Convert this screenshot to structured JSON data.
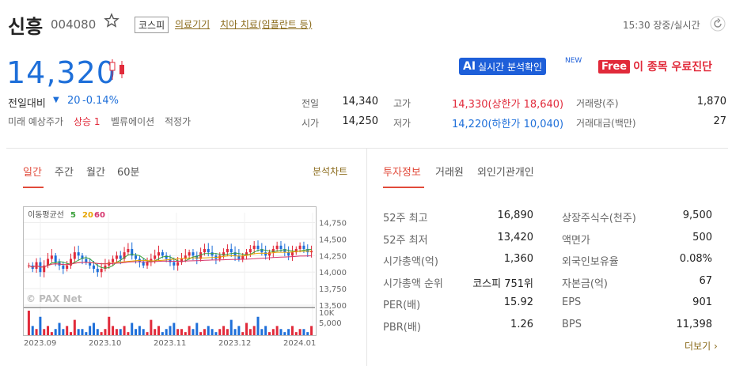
{
  "header": {
    "stock_name": "신흥",
    "stock_code": "004080",
    "market_tag": "코스피",
    "sector_link": "의료기기",
    "theme_link": "치아 치료(임플란트 등)",
    "time_status": "15:30 장중/실시간"
  },
  "price": {
    "current": "14,320",
    "change_label": "전일대비",
    "change_value": "20",
    "change_pct": "-0.14%",
    "forecast_label": "미래 예상주가",
    "forecast_value": "상승 1",
    "valuation_label": "벨류에이션",
    "valuation_value": "적정가"
  },
  "promo": {
    "ai_badge": "AI",
    "ai_text": "실시간 분석확인",
    "new_tag": "NEW",
    "free_badge": "Free",
    "free_text": "이 종목 우료진단"
  },
  "quote": {
    "prev_label": "전일",
    "prev_value": "14,340",
    "open_label": "시가",
    "open_value": "14,250",
    "high_label": "고가",
    "high_value": "14,330(상한가 18,640)",
    "low_label": "저가",
    "low_value": "14,220(하한가 10,040)",
    "volume_label": "거래량(주)",
    "volume_value": "1,870",
    "amount_label": "거래대금(백만)",
    "amount_value": "27"
  },
  "chart_tabs": [
    "일간",
    "주간",
    "월간",
    "60분"
  ],
  "chart_link": "분석차트",
  "info_tabs": [
    "투자정보",
    "거래원",
    "외인기관개인"
  ],
  "chart_data": {
    "type": "candlestick",
    "legend": {
      "label": "이동평균선",
      "ma": [
        "5",
        "20",
        "60"
      ],
      "colors": [
        "#3aa03a",
        "#e6a400",
        "#d6336c"
      ]
    },
    "watermark": "© PAX Net",
    "y_ticks": [
      "14,750",
      "14,500",
      "14,250",
      "14,000",
      "13,750",
      "13,500"
    ],
    "volume_ticks": [
      "10K",
      "5,000"
    ],
    "x_ticks": [
      "2023.09",
      "2023.10",
      "2023.11",
      "2023.12",
      "2024.01"
    ],
    "ylim": [
      13500,
      14900
    ],
    "closes": [
      14100,
      14050,
      14150,
      14000,
      14100,
      14200,
      14250,
      14150,
      14100,
      14050,
      14100,
      14200,
      14300,
      14250,
      14200,
      14150,
      14100,
      14050,
      14000,
      14050,
      14100,
      14150,
      14200,
      14250,
      14200,
      14300,
      14350,
      14250,
      14200,
      14150,
      14100,
      14150,
      14200,
      14250,
      14300,
      14250,
      14200,
      14150,
      14100,
      14150,
      14200,
      14250,
      14300,
      14250,
      14200,
      14300,
      14350,
      14300,
      14250,
      14200,
      14250,
      14300,
      14350,
      14300,
      14250,
      14200,
      14250,
      14300,
      14350,
      14400,
      14350,
      14300,
      14250,
      14300,
      14350,
      14400,
      14350,
      14300,
      14250,
      14300,
      14350,
      14400,
      14350,
      14300,
      14320
    ],
    "volumes": [
      8,
      3,
      2,
      6,
      2,
      3,
      1,
      2,
      4,
      2,
      3,
      1,
      5,
      2,
      2,
      1,
      3,
      4,
      2,
      1,
      2,
      6,
      3,
      2,
      2,
      3,
      1,
      4,
      2,
      3,
      2,
      1,
      5,
      2,
      3,
      1,
      2,
      3,
      4,
      2,
      2,
      1,
      3,
      2,
      4,
      1,
      2,
      3,
      2,
      1,
      2,
      3,
      2,
      5,
      2,
      3,
      1,
      4,
      2,
      3,
      6,
      2,
      3,
      1,
      2,
      3,
      2,
      1,
      2,
      3,
      1,
      2,
      2,
      1,
      3
    ]
  },
  "invest": {
    "left": [
      {
        "label": "52주 최고",
        "value": "16,890"
      },
      {
        "label": "52주 최저",
        "value": "13,420"
      },
      {
        "label": "시가총액(억)",
        "value": "1,360"
      },
      {
        "label": "시가총액 순위",
        "value": "코스피 751위"
      },
      {
        "label": "PER(배)",
        "value": "15.92"
      },
      {
        "label": "PBR(배)",
        "value": "1.26"
      }
    ],
    "right": [
      {
        "label": "상장주식수(천주)",
        "value": "9,500"
      },
      {
        "label": "액면가",
        "value": "500"
      },
      {
        "label": "외국인보유율",
        "value": "0.08%"
      },
      {
        "label": "자본금(억)",
        "value": "67"
      },
      {
        "label": "EPS",
        "value": "901"
      },
      {
        "label": "BPS",
        "value": "11,398"
      }
    ],
    "more_link": "더보기"
  }
}
